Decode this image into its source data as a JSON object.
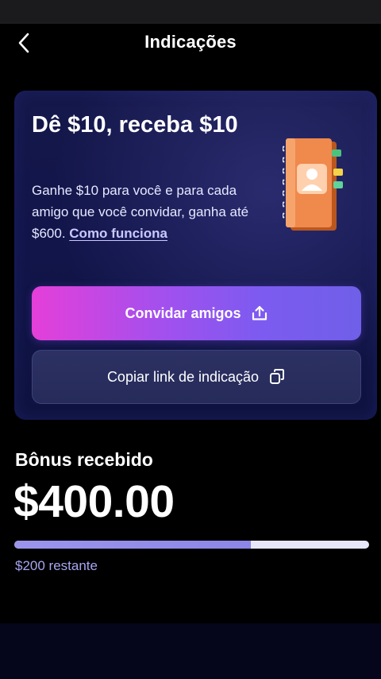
{
  "header": {
    "title": "Indicações"
  },
  "promo": {
    "title": "Dê $10, receba $10",
    "description": "Ganhe $10 para você e para cada amigo que você convidar, ganha até $600.",
    "how_it_works_link": "Como funciona",
    "invite_button_label": "Convidar amigos",
    "copy_link_button_label": "Copiar link de indicação"
  },
  "bonus": {
    "label": "Bônus recebido",
    "amount": "$400.00",
    "remaining": "$200 restante",
    "progress_fraction": 0.667
  },
  "colors": {
    "invite_gradient_start": "#e53fd9",
    "invite_gradient_end": "#6f5fe8",
    "progress_fill": "#9b95ee",
    "progress_track": "#e6e7f8",
    "remaining_text": "#a7a5f0"
  },
  "icons": {
    "back": "chevron-left-icon",
    "invite": "share-upload-icon",
    "copy": "copy-icon",
    "illustration": "contacts-notebook-icon"
  }
}
